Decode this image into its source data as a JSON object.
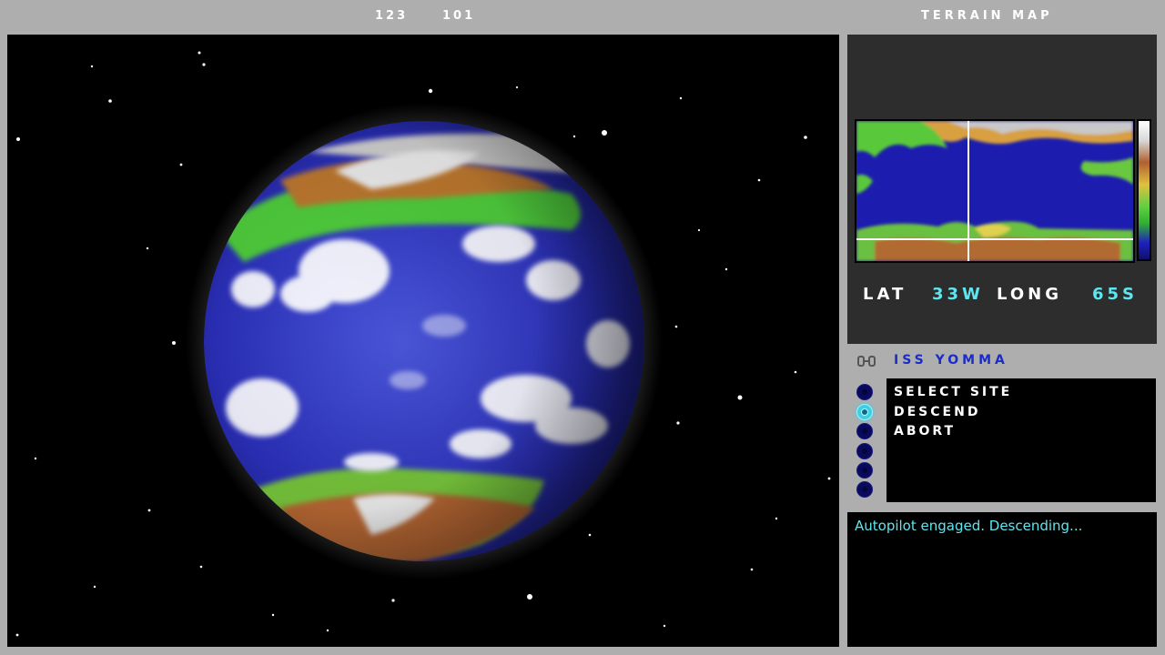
{
  "header": {
    "coord_a": "123",
    "coord_b": "101",
    "map_title": "TERRAIN MAP"
  },
  "terrain": {
    "lat_label": "LAT",
    "lat_value": "33W",
    "long_label": "LONG",
    "long_value": "65S"
  },
  "ship": {
    "icon": "ship-icon",
    "name": "ISS YOMMA"
  },
  "menu": {
    "items": [
      {
        "label": "SELECT SITE",
        "selected": false
      },
      {
        "label": "DESCEND",
        "selected": true
      },
      {
        "label": "ABORT",
        "selected": false
      },
      {
        "label": "",
        "selected": false
      },
      {
        "label": "",
        "selected": false
      },
      {
        "label": "",
        "selected": false
      }
    ]
  },
  "log": {
    "message": "Autopilot engaged. Descending..."
  },
  "colors": {
    "accent": "#5ee6ee",
    "ship_name": "#1a2cc8",
    "panel": "#2d2d2d",
    "frame": "#aeaeae"
  }
}
